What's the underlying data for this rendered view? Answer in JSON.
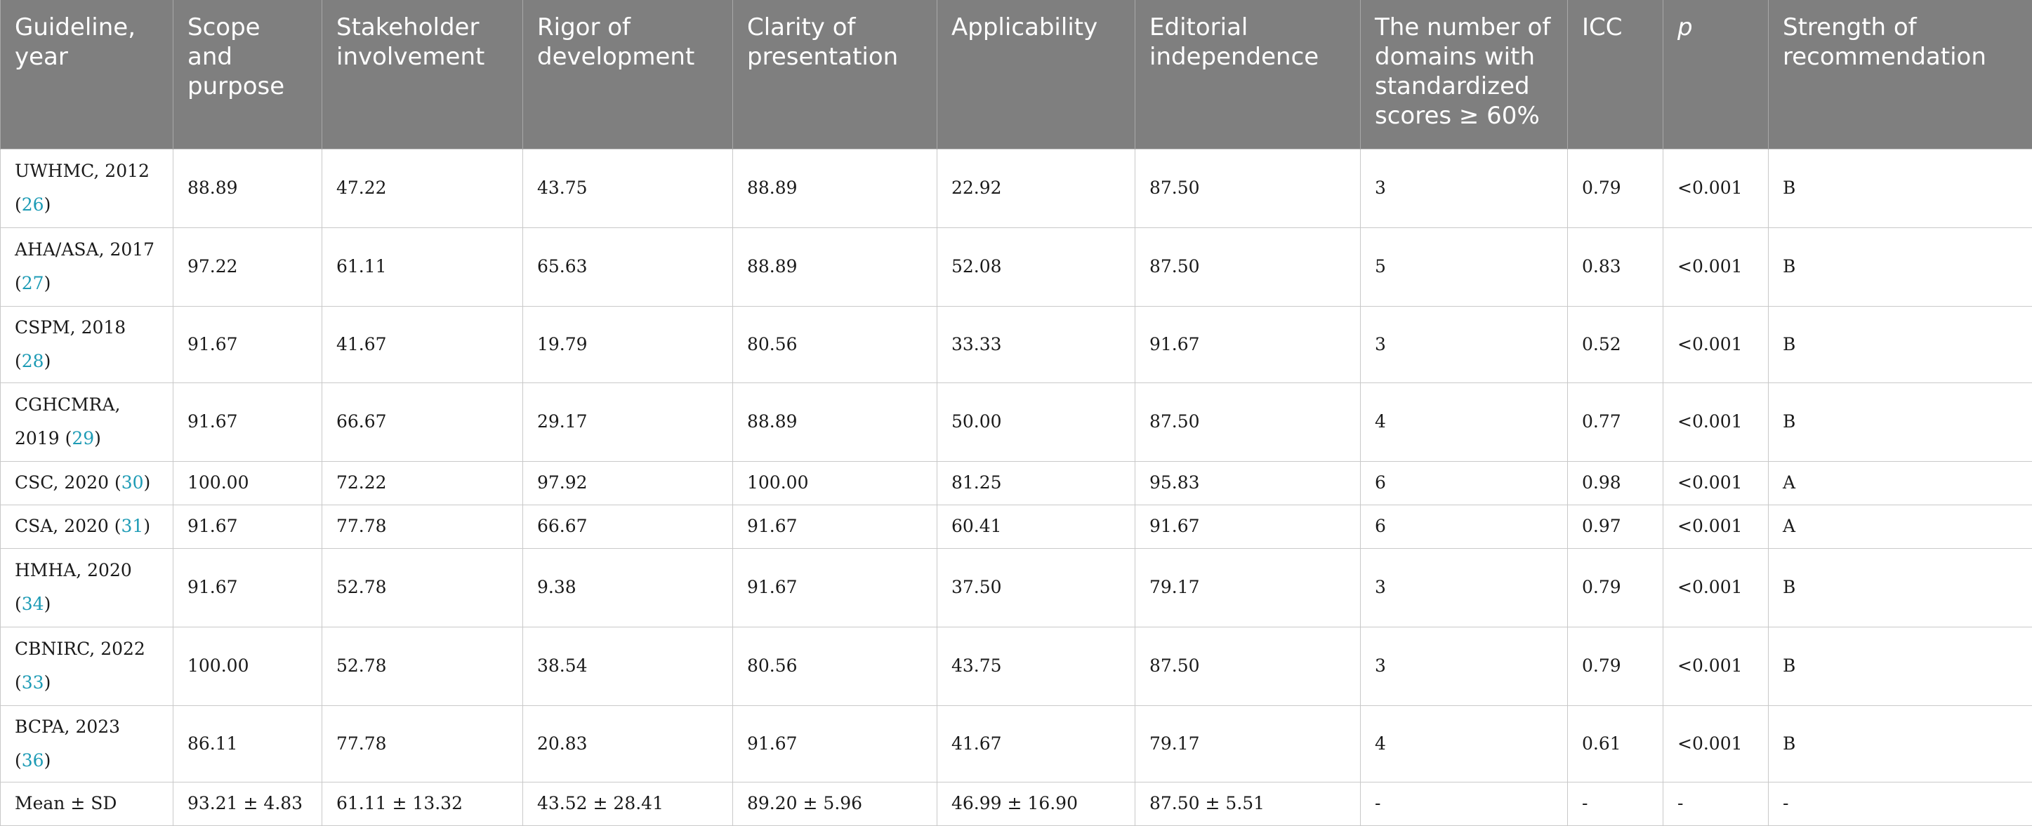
{
  "columns": [
    "Guideline, year",
    "Scope and purpose",
    "Stakeholder involvement",
    "Rigor of development",
    "Clarity of presentation",
    "Applicability",
    "Editorial independence",
    "The number of domains with standardized scores ≥ 60%",
    "ICC",
    "p",
    "Strength of recommendation"
  ],
  "rows": [
    {
      "name": "UWHMC, 2012",
      "ref": "26",
      "values": [
        "88.89",
        "47.22",
        "43.75",
        "88.89",
        "22.92",
        "87.50",
        "3",
        "0.79",
        "<0.001",
        "B"
      ]
    },
    {
      "name": "AHA/ASA, 2017",
      "ref": "27",
      "values": [
        "97.22",
        "61.11",
        "65.63",
        "88.89",
        "52.08",
        "87.50",
        "5",
        "0.83",
        "<0.001",
        "B"
      ]
    },
    {
      "name": "CSPM, 2018",
      "ref": "28",
      "values": [
        "91.67",
        "41.67",
        "19.79",
        "80.56",
        "33.33",
        "91.67",
        "3",
        "0.52",
        "<0.001",
        "B"
      ]
    },
    {
      "name": "CGHCMRA, 2019",
      "ref": "29",
      "values": [
        "91.67",
        "66.67",
        "29.17",
        "88.89",
        "50.00",
        "87.50",
        "4",
        "0.77",
        "<0.001",
        "B"
      ]
    },
    {
      "name": "CSC, 2020",
      "ref": "30",
      "values": [
        "100.00",
        "72.22",
        "97.92",
        "100.00",
        "81.25",
        "95.83",
        "6",
        "0.98",
        "<0.001",
        "A"
      ]
    },
    {
      "name": "CSA, 2020",
      "ref": "31",
      "values": [
        "91.67",
        "77.78",
        "66.67",
        "91.67",
        "60.41",
        "91.67",
        "6",
        "0.97",
        "<0.001",
        "A"
      ]
    },
    {
      "name": "HMHA, 2020",
      "ref": "34",
      "values": [
        "91.67",
        "52.78",
        "9.38",
        "91.67",
        "37.50",
        "79.17",
        "3",
        "0.79",
        "<0.001",
        "B"
      ]
    },
    {
      "name": "CBNIRC, 2022",
      "ref": "33",
      "values": [
        "100.00",
        "52.78",
        "38.54",
        "80.56",
        "43.75",
        "87.50",
        "3",
        "0.79",
        "<0.001",
        "B"
      ]
    },
    {
      "name": "BCPA, 2023",
      "ref": "36",
      "values": [
        "86.11",
        "77.78",
        "20.83",
        "91.67",
        "41.67",
        "79.17",
        "4",
        "0.61",
        "<0.001",
        "B"
      ]
    },
    {
      "name": "Mean ± SD",
      "ref": "",
      "values": [
        "93.21 ± 4.83",
        "61.11 ± 13.32",
        "43.52 ± 28.41",
        "89.20 ± 5.96",
        "46.99 ± 16.90",
        "87.50 ± 5.51",
        "-",
        "-",
        "-",
        "-"
      ]
    }
  ]
}
